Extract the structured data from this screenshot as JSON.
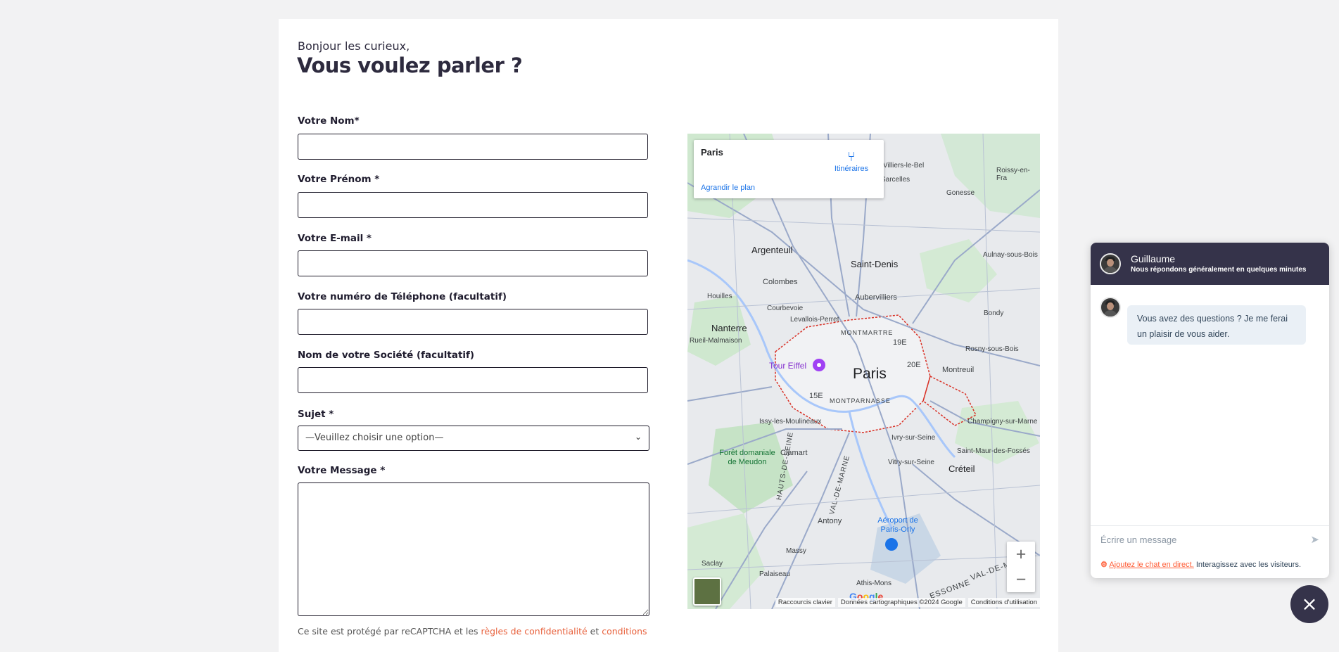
{
  "form": {
    "greeting": "Bonjour les curieux,",
    "title": "Vous voulez parler ?",
    "fields": {
      "nom": "Votre Nom*",
      "prenom": "Votre Prénom *",
      "email": "Votre E-mail *",
      "phone": "Votre numéro de Téléphone (facultatif)",
      "company": "Nom de votre Société (facultatif)",
      "subject": "Sujet *",
      "message": "Votre Message *"
    },
    "subject_selected": "—Veuillez choisir une option—",
    "note_prefix": "Ce site est protégé par reCAPTCHA et les ",
    "note_link1": "règles de confidentialité",
    "note_mid": " et ",
    "note_link2": "conditions"
  },
  "map": {
    "place": "Paris",
    "directions": "Itinéraires",
    "enlarge": "Agrandir le plan",
    "zoom_in": "+",
    "zoom_out": "−",
    "google": "Google",
    "attr_shortcuts": "Raccourcis clavier",
    "attr_data": "Données cartographiques ©2024 Google",
    "attr_terms": "Conditions d'utilisation",
    "labels": {
      "paris": "Paris",
      "tour_eiffel": "Tour Eiffel",
      "argenteuil": "Argenteuil",
      "saint_denis": "Saint-Denis",
      "nanterre": "Nanterre",
      "creteil": "Créteil",
      "montreuil": "Montreuil",
      "aubervilliers": "Aubervilliers",
      "colombes": "Colombes",
      "orly": "Aéroport de Paris-Orly",
      "clamart": "Clamart",
      "antony": "Antony",
      "hauts_de_seine": "HAUTS-DE-SEINE",
      "val_de_marne": "VAL-DE-MARNE",
      "essonne": "ESSONNE",
      "montmartre": "MONTMARTRE",
      "montparnasse": "MONTPARNASSE",
      "e19": "19E",
      "e20": "20E",
      "e15": "15E",
      "gonesse": "Gonesse",
      "bondy": "Bondy",
      "sarcelles": "Sarcelles",
      "villiers_le_bel": "Villiers-le-Bel",
      "massy": "Massy",
      "palaiseau": "Palaiseau",
      "saclay": "Saclay",
      "athis_mons": "Athis-Mons",
      "levallois": "Levallois-Perret",
      "courbevoie": "Courbevoie",
      "issy": "Issy-les-Moulineaux",
      "ivry": "Ivry-sur-Seine",
      "vitry": "Vitry-sur-Seine",
      "meudon": "Forêt domaniale de Meudon",
      "rueil": "Rueil-Malmaison",
      "houilles": "Houilles",
      "aulnay": "Aulnay-sous-Bois",
      "rosny": "Rosny-sous-Bois",
      "champigny": "Champigny-sur-Marne",
      "saint_maur": "Saint-Maur-des-Fossés",
      "roissy": "Roissy-en-Fra"
    }
  },
  "chat": {
    "agent_name": "Guillaume",
    "agent_subtitle": "Nous répondons généralement en quelques minutes",
    "message": "Vous avez des questions ? Je me ferai un plaisir de vous aider.",
    "input_placeholder": "Écrire un message",
    "footer_link": "Ajoutez le chat en direct.",
    "footer_text": " Interagissez avec les visiteurs.",
    "close": "×"
  },
  "colors": {
    "accent": "#e8613c",
    "chat_header": "#35334a",
    "hubspot": "#ff5c35"
  }
}
